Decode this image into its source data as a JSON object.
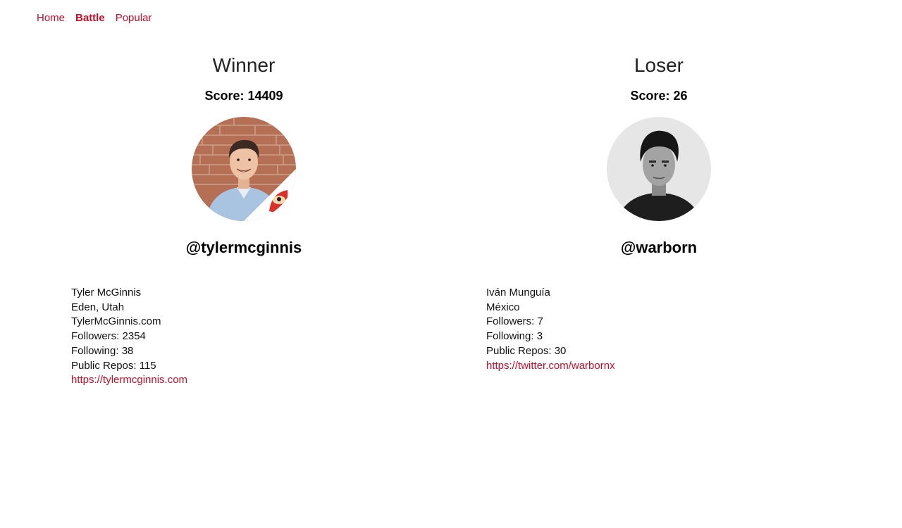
{
  "nav": {
    "items": [
      {
        "label": "Home",
        "active": false
      },
      {
        "label": "Battle",
        "active": true
      },
      {
        "label": "Popular",
        "active": false
      }
    ]
  },
  "players": {
    "winner": {
      "header": "Winner",
      "score": "Score: 14409",
      "username": "@tylermcginnis",
      "name": "Tyler McGinnis",
      "location": "Eden, Utah",
      "company": "TylerMcGinnis.com",
      "followers": "Followers: 2354",
      "following": "Following: 38",
      "repos": "Public Repos: 115",
      "blog": "https://tylermcginnis.com"
    },
    "loser": {
      "header": "Loser",
      "score": "Score: 26",
      "username": "@warborn",
      "name": "Iván Munguía",
      "location": "México",
      "followers": "Followers: 7",
      "following": "Following: 3",
      "repos": "Public Repos: 30",
      "blog": "https://twitter.com/warbornx"
    }
  },
  "colors": {
    "accent": "#c0102a"
  }
}
